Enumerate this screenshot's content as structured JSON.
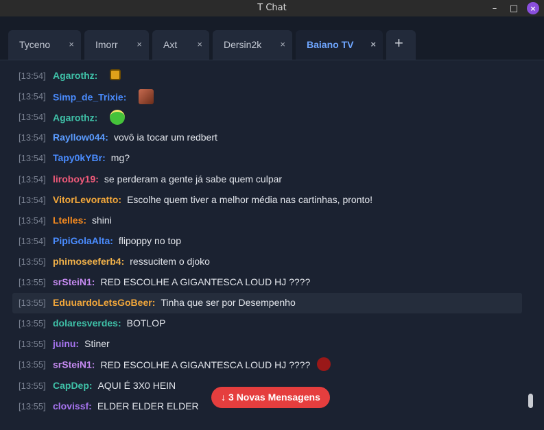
{
  "window": {
    "title": "T Chat",
    "minimize": "–",
    "maximize": "□",
    "close": "×"
  },
  "tabs": [
    {
      "label": "Tyceno",
      "close": "×"
    },
    {
      "label": "Imorr",
      "close": "×"
    },
    {
      "label": "Axt",
      "close": "×"
    },
    {
      "label": "Dersin2k",
      "close": "×"
    },
    {
      "label": "Baiano TV",
      "close": "×",
      "active": true
    }
  ],
  "add_tab": "+",
  "messages": [
    {
      "time": "[13:54]",
      "user": "Agarothz:",
      "color": "#3fc1a8",
      "text": "",
      "emote": "angry-face-emote"
    },
    {
      "time": "[13:54]",
      "user": "Simp_de_Trixie:",
      "color": "#4a8cff",
      "text": "",
      "emote": "photo-face-emote"
    },
    {
      "time": "[13:54]",
      "user": "Agarothz:",
      "color": "#3fc1a8",
      "text": "",
      "emote": "halo-face-emote"
    },
    {
      "time": "[13:54]",
      "user": "Rayllow044:",
      "color": "#5b9cff",
      "text": "vovô ia tocar um redbert",
      "emote": ""
    },
    {
      "time": "[13:54]",
      "user": "Tapy0kYBr:",
      "color": "#4a8cff",
      "text": "mg?",
      "emote": ""
    },
    {
      "time": "[13:54]",
      "user": "liroboy19:",
      "color": "#f05a7a",
      "text": "se perderam a gente já sabe quem culpar",
      "emote": ""
    },
    {
      "time": "[13:54]",
      "user": "VitorLevoratto:",
      "color": "#f2a73b",
      "text": "Escolhe quem tiver a melhor média nas cartinhas, pronto!",
      "emote": ""
    },
    {
      "time": "[13:54]",
      "user": "Ltelles:",
      "color": "#f58a1f",
      "text": "shini",
      "emote": ""
    },
    {
      "time": "[13:54]",
      "user": "PipiGolaAlta:",
      "color": "#4a8cff",
      "text": "flipoppy no top",
      "emote": ""
    },
    {
      "time": "[13:55]",
      "user": "phimoseeferb4:",
      "color": "#f2b24a",
      "text": "ressucitem o djoko",
      "emote": ""
    },
    {
      "time": "[13:55]",
      "user": "srSteiN1:",
      "color": "#c58af0",
      "text": "RED ESCOLHE A GIGANTESCA LOUD HJ ????",
      "emote": ""
    },
    {
      "time": "[13:55]",
      "user": "EduuardoLetsGoBeer:",
      "color": "#f2a73b",
      "text": "Tinha que ser por Desempenho",
      "emote": "",
      "highlight": true
    },
    {
      "time": "[13:55]",
      "user": "dolaresverdes:",
      "color": "#3fc1a8",
      "text": "BOTLOP",
      "emote": ""
    },
    {
      "time": "[13:55]",
      "user": "juinu:",
      "color": "#a774f0",
      "text": "Stiner",
      "emote": ""
    },
    {
      "time": "[13:55]",
      "user": "srSteiN1:",
      "color": "#c58af0",
      "text": "RED ESCOLHE A GIGANTESCA LOUD HJ ????",
      "emote": "red-face-emote"
    },
    {
      "time": "[13:55]",
      "user": "CapDep:",
      "color": "#3fc1a8",
      "text": "AQUI É 3X0 HEIN",
      "emote": ""
    },
    {
      "time": "[13:55]",
      "user": "clovissf:",
      "color": "#a774f0",
      "text": "ELDER ELDER ELDER",
      "emote": ""
    }
  ],
  "new_messages_button": "↓ 3 Novas Mensagens"
}
